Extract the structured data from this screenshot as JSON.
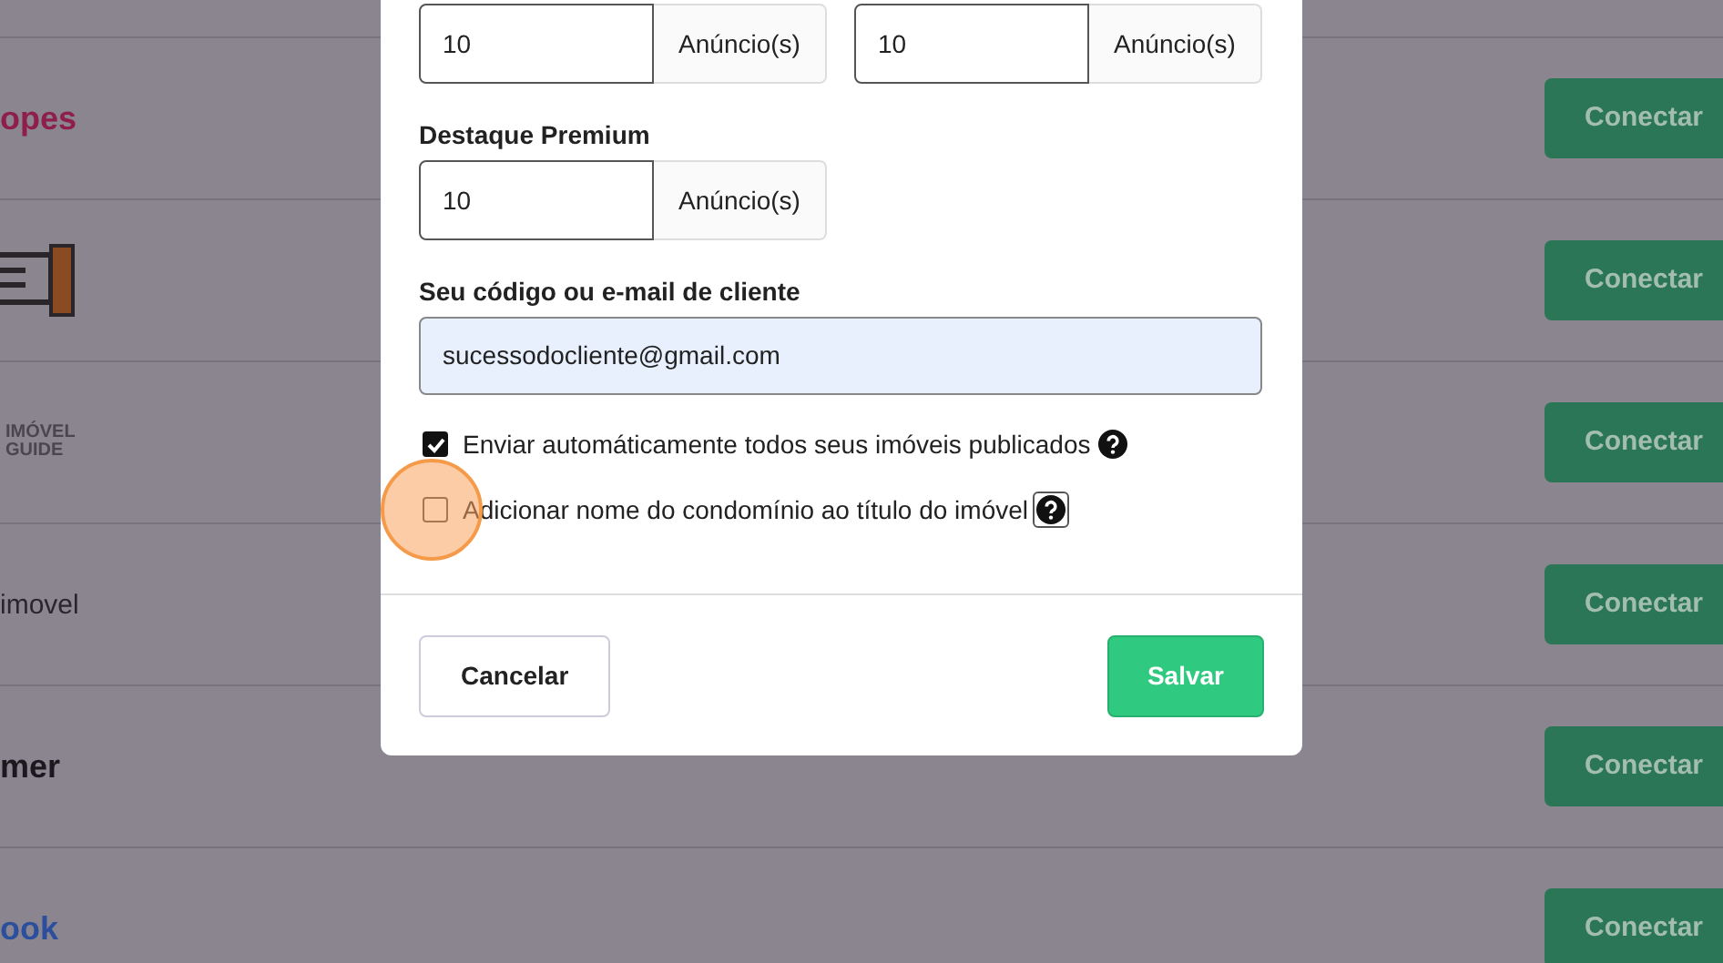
{
  "background_rows": [
    {
      "kind": "text",
      "logo": "opes",
      "color": "#8e1f4c",
      "button": "Conectar"
    },
    {
      "kind": "drawing",
      "button": "Conectar"
    },
    {
      "kind": "stacked",
      "logo": "IMÓVEL GUIDE",
      "color": "#4a4650",
      "button": "Conectar"
    },
    {
      "kind": "thin",
      "logo": "imovel",
      "color": "#2a262c",
      "button": "Conectar"
    },
    {
      "kind": "text",
      "logo": "mer",
      "color": "#1c181d",
      "button": "Conectar"
    },
    {
      "kind": "text",
      "logo": "ook",
      "color": "#2b4f9c",
      "button": "Conectar"
    }
  ],
  "modal": {
    "quantity_fields": [
      {
        "value": "10",
        "unit": "Anúncio(s)"
      },
      {
        "value": "10",
        "unit": "Anúncio(s)"
      }
    ],
    "premium": {
      "label": "Destaque Premium",
      "value": "10",
      "unit": "Anúncio(s)"
    },
    "client": {
      "label": "Seu código ou e-mail de cliente",
      "value": "sucessodocliente@gmail.com"
    },
    "checkboxes": [
      {
        "label": "Enviar automáticamente todos seus imóveis publicados",
        "checked": true,
        "help_focused": false,
        "click_highlight": false
      },
      {
        "label": "Adicionar nome do condomínio ao título do imóvel",
        "checked": false,
        "help_focused": true,
        "click_highlight": true
      }
    ],
    "buttons": [
      {
        "label": "Cancelar",
        "kind": "secondary"
      },
      {
        "label": "Salvar",
        "kind": "primary"
      }
    ]
  }
}
